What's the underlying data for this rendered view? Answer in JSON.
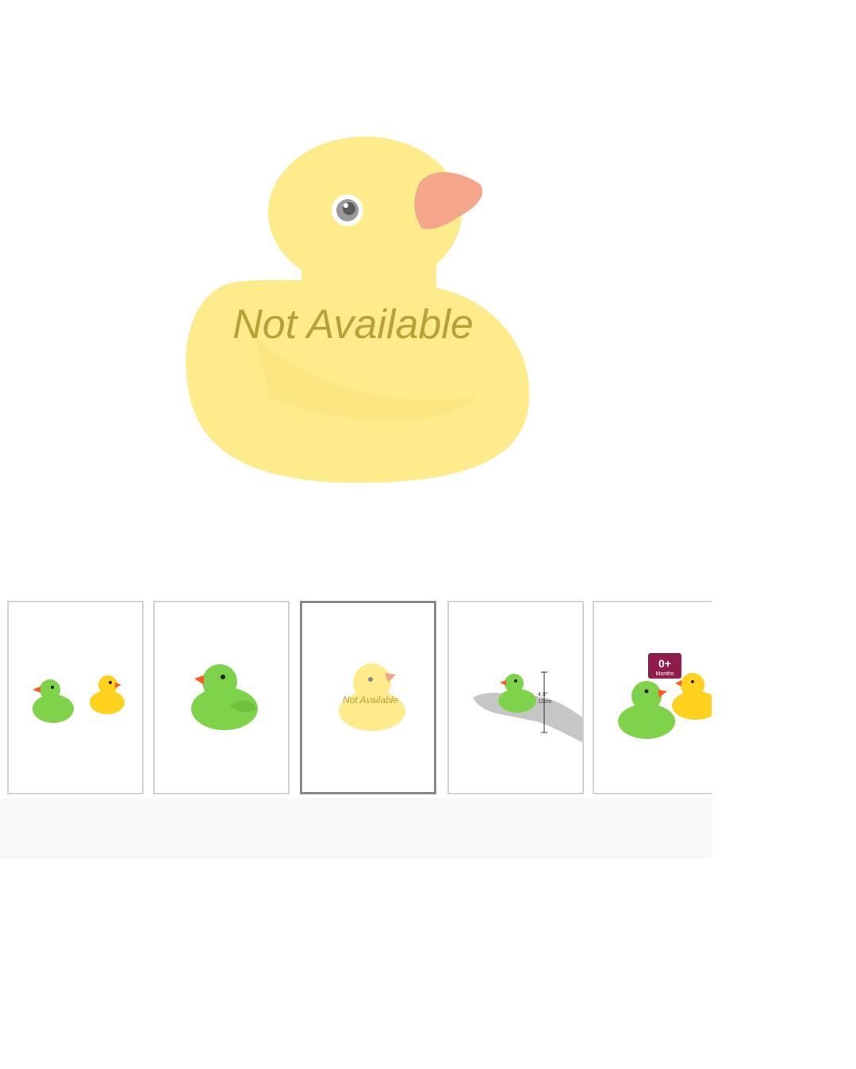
{
  "main_image": {
    "overlay_text": "Not Available",
    "icon": "rubber-duck-yellow"
  },
  "thumbnails": [
    {
      "icon": "green-and-yellow-ducks",
      "selected": false
    },
    {
      "icon": "green-duck",
      "selected": false
    },
    {
      "icon": "yellow-duck-not-available",
      "selected": true,
      "overlay_text": "Not Available"
    },
    {
      "icon": "duck-on-hand-size",
      "selected": false,
      "size_labels": [
        "4.9\"",
        "12cm"
      ]
    },
    {
      "icon": "age-badge-ducks",
      "selected": false,
      "badge_main": "0+",
      "badge_sub": "Months"
    }
  ],
  "colors": {
    "duck_yellow_faded": "#fdeb8c",
    "beak_faded": "#f4a58a",
    "overlay_text": "#b8a137",
    "green_duck": "#7fd34a",
    "yellow_duck": "#ffd11f",
    "badge": "#8f1d4c",
    "thumb_border": "#d2d2d2",
    "thumb_border_selected": "#8a8a8a"
  }
}
